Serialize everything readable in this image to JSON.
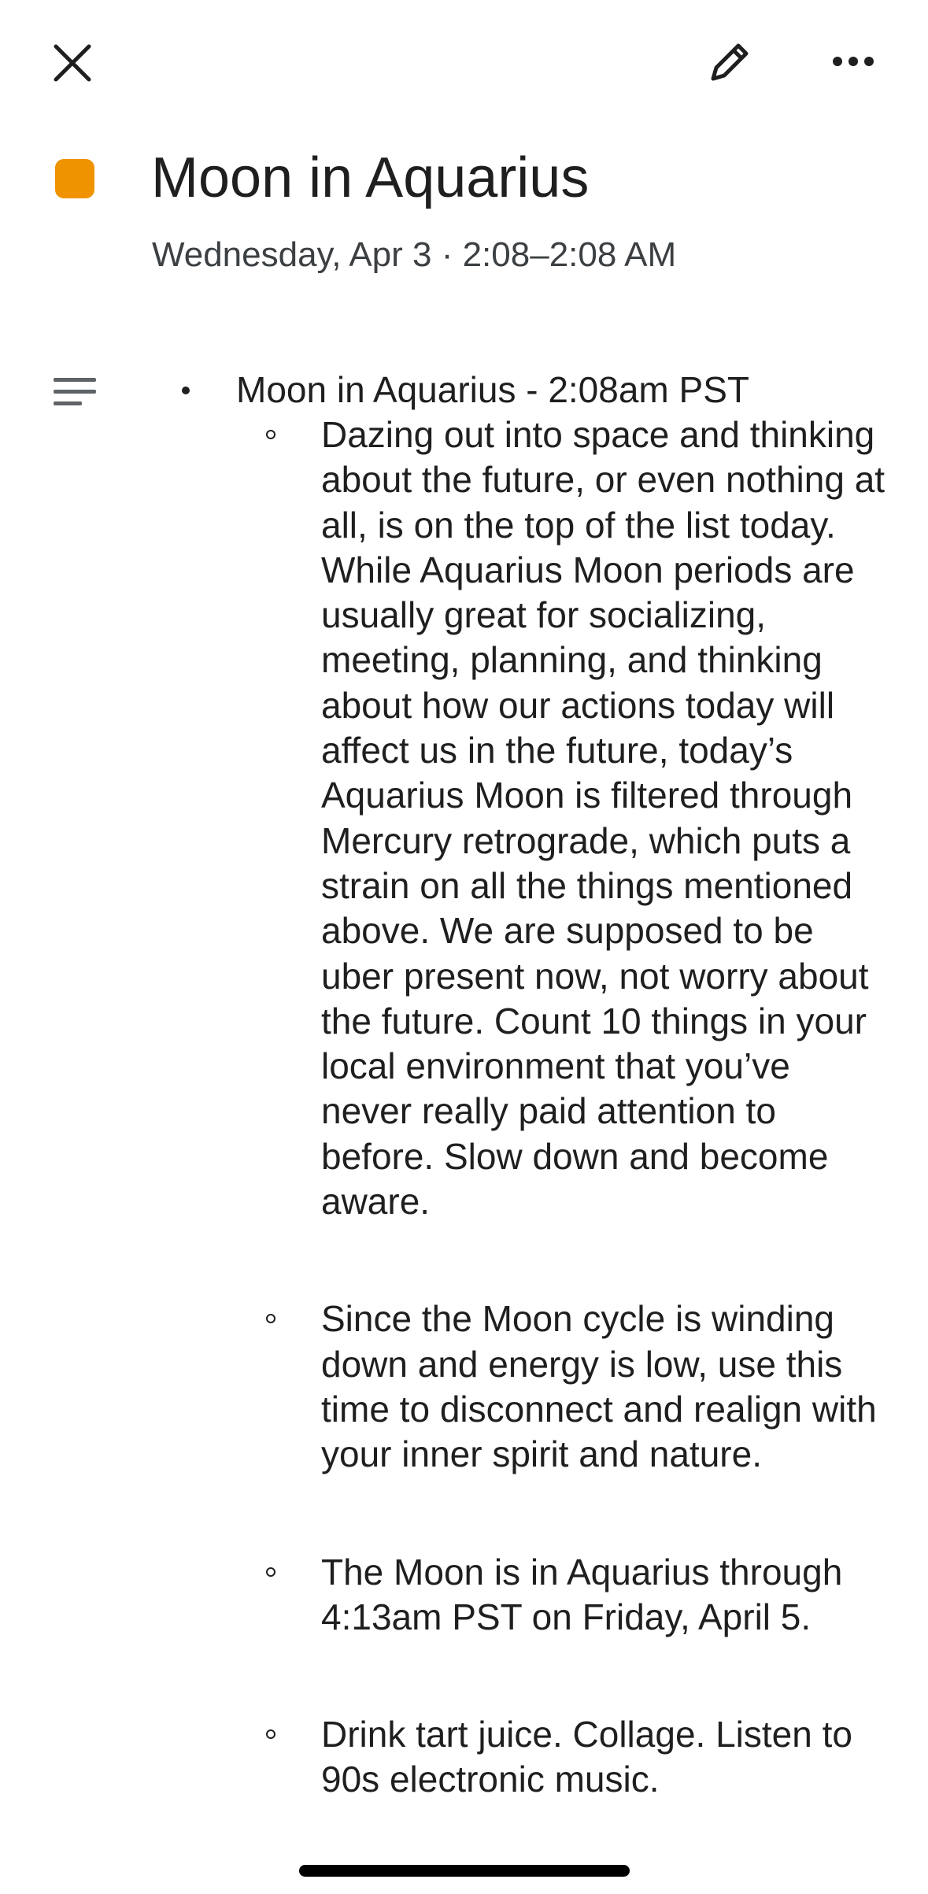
{
  "toolbar": {
    "close_icon": "close-icon",
    "edit_icon": "pencil-icon",
    "more_icon": "more-horizontal-icon"
  },
  "event": {
    "color": "#F09300",
    "title": "Moon in Aquarius",
    "datetime": "Wednesday, Apr 3 · 2:08–2:08 AM"
  },
  "description": {
    "icon": "notes-icon",
    "heading": "Moon in Aquarius - 2:08am PST",
    "items": [
      "Dazing out into space and thinking about the future, or even nothing at all, is on the top of the list today. While Aquarius Moon periods are usually great for socializing, meeting, planning, and thinking about how our actions today will affect us in the future, today’s Aquarius Moon is filtered through Mercury retrograde, which puts a strain on all the things mentioned above. We are supposed to be uber present now, not worry about the future. Count 10 things in your local environment that you’ve never really paid attention to before. Slow down and become aware.",
      "Since the Moon cycle is winding down and energy is low, use this time to disconnect and realign with your inner spirit and nature.",
      "The Moon is in Aquarius through 4:13am PST on Friday, April 5.",
      "Drink tart juice. Collage. Listen to 90s electronic music."
    ]
  }
}
